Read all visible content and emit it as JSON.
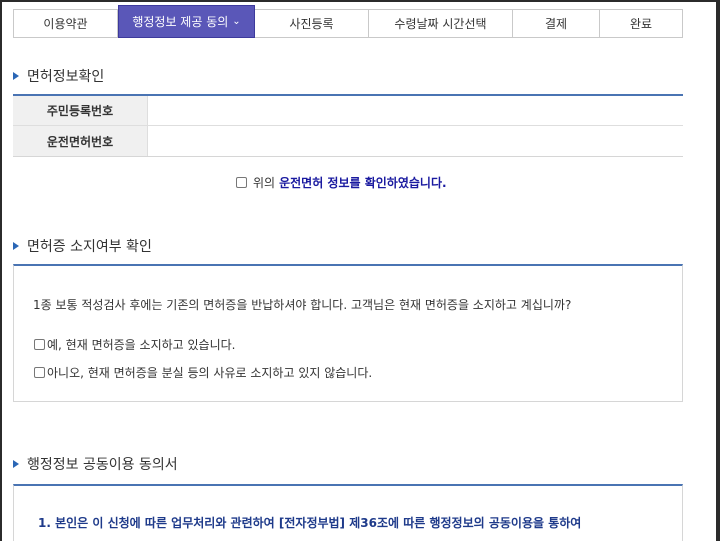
{
  "steps": [
    {
      "label": "이용약관",
      "active": false
    },
    {
      "label": "행정정보 제공 동의",
      "active": true
    },
    {
      "label": "사진등록",
      "active": false
    },
    {
      "label": "수령날짜 시간선택",
      "active": false
    },
    {
      "label": "결제",
      "active": false
    },
    {
      "label": "완료",
      "active": false
    }
  ],
  "license_section": {
    "title": "면허정보확인",
    "rows": [
      {
        "label": "주민등록번호",
        "value": ""
      },
      {
        "label": "운전면허번호",
        "value": ""
      }
    ],
    "confirm_prefix": "위의",
    "confirm_text": "운전면허 정보를 확인하였습니다."
  },
  "possession_section": {
    "title": "면허증 소지여부 확인",
    "question": "1종 보통 적성검사 후에는 기존의 면허증을 반납하셔야 합니다. 고객님은 현재 면허증을 소지하고 계십니까?",
    "options": [
      "예, 현재 면허증을 소지하고 있습니다.",
      "아니오, 현재 면허증을 분실 등의 사유로 소지하고 있지 않습니다."
    ]
  },
  "consent_section": {
    "title": "행정정보 공동이용 동의서",
    "item1": "1. 본인은 이 신청에 따른 업무처리와 관련하여 [전자정부법] 제36조에 따른 행정정보의 공동이용을 통하여",
    "item2": ""
  },
  "colors": {
    "accent": "#5a57b8",
    "section_border": "#4a74b3",
    "emphasis": "#1a1aa0"
  }
}
